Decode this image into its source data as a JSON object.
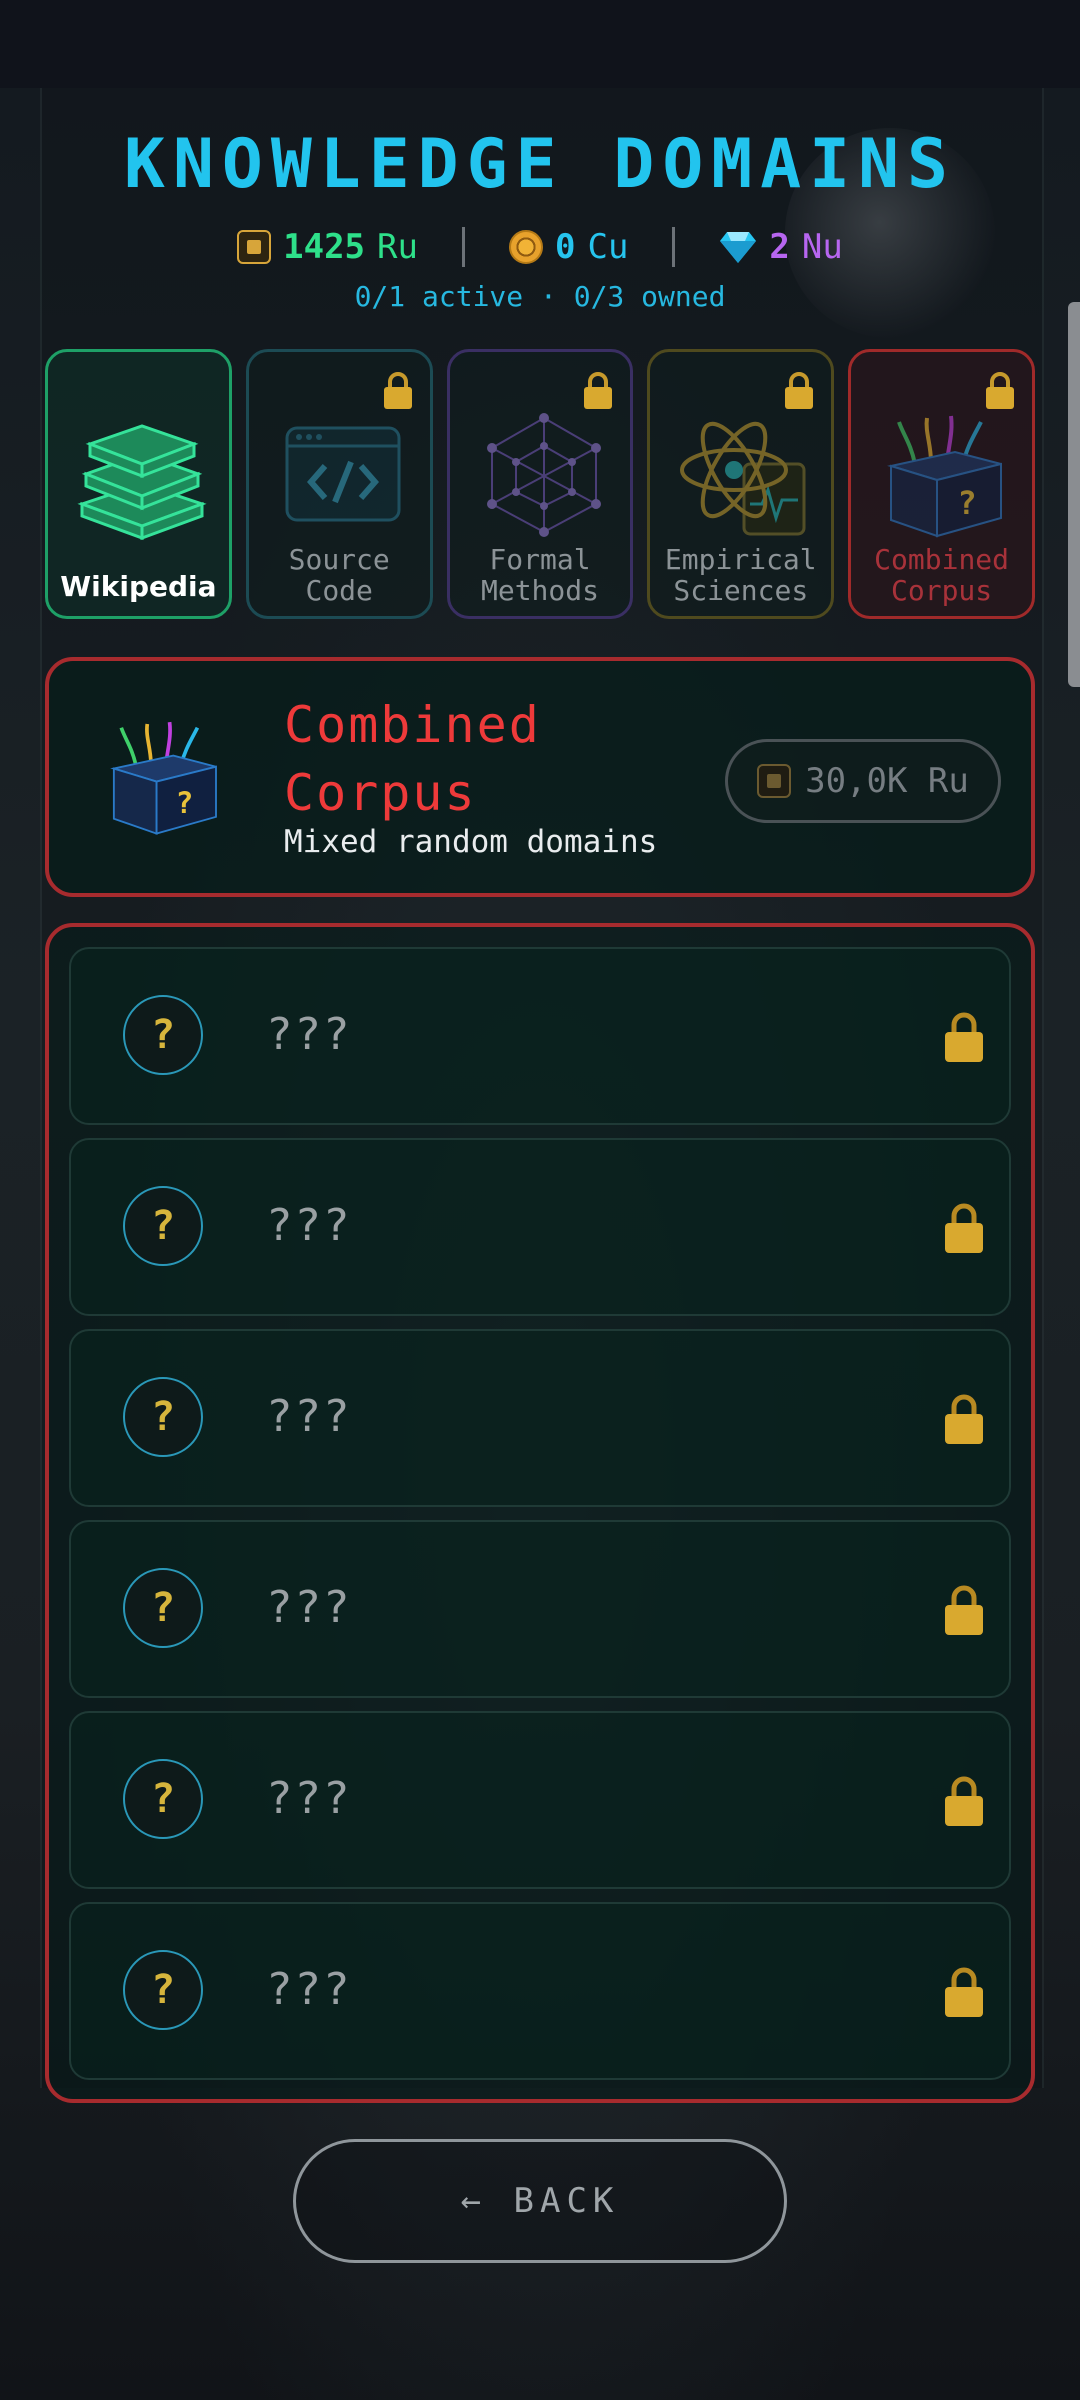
{
  "header": {
    "title": "KNOWLEDGE DOMAINS",
    "status": "0/1 active · 0/3 owned"
  },
  "currencies": [
    {
      "icon": "chip-icon",
      "amount": "1425",
      "unit": "Ru",
      "color": "#2ee08a"
    },
    {
      "icon": "coin-icon",
      "amount": "0",
      "unit": "Cu",
      "color": "#26c4ee"
    },
    {
      "icon": "gem-icon",
      "amount": "2",
      "unit": "Nu",
      "color": "#b766f0"
    }
  ],
  "domains": [
    {
      "label_line1": "Wikipedia",
      "label_line2": "",
      "locked": false,
      "state": "active"
    },
    {
      "label_line1": "Source",
      "label_line2": "Code",
      "locked": true
    },
    {
      "label_line1": "Formal",
      "label_line2": "Methods",
      "locked": true
    },
    {
      "label_line1": "Empirical",
      "label_line2": "Sciences",
      "locked": true
    },
    {
      "label_line1": "Combined",
      "label_line2": "Corpus",
      "locked": true,
      "state": "selected"
    }
  ],
  "selected": {
    "name_line1": "Combined",
    "name_line2": "Corpus",
    "description": "Mixed random domains",
    "price": "30,0K Ru"
  },
  "items": [
    {
      "icon_text": "?",
      "label": "???"
    },
    {
      "icon_text": "?",
      "label": "???"
    },
    {
      "icon_text": "?",
      "label": "???"
    },
    {
      "icon_text": "?",
      "label": "???"
    },
    {
      "icon_text": "?",
      "label": "???"
    },
    {
      "icon_text": "?",
      "label": "???"
    }
  ],
  "footer": {
    "back_label": "← BACK"
  },
  "colors": {
    "accent": "#22c4ee",
    "selected_border": "#a72b2e",
    "selected_name": "#ee3a3a"
  }
}
